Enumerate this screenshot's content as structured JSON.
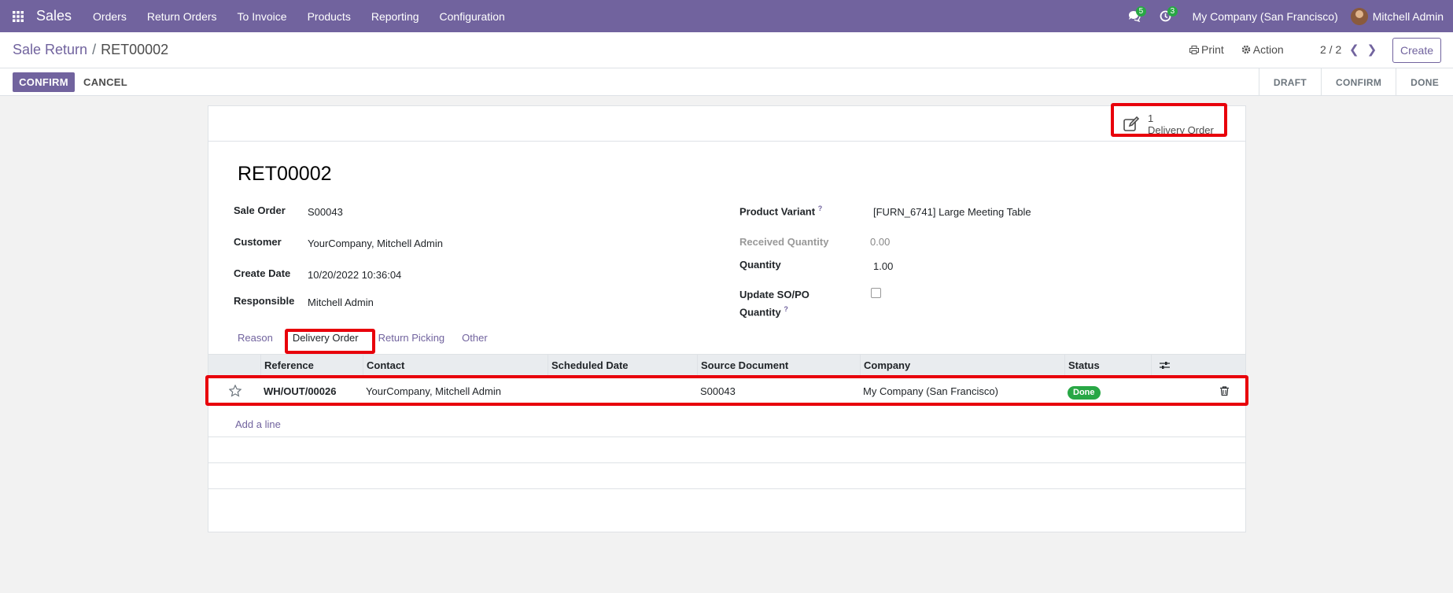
{
  "navbar": {
    "app_name": "Sales",
    "menu": [
      "Orders",
      "Return Orders",
      "To Invoice",
      "Products",
      "Reporting",
      "Configuration"
    ],
    "messages_count": "5",
    "activities_count": "3",
    "company": "My Company (San Francisco)",
    "user": "Mitchell Admin"
  },
  "control": {
    "breadcrumb_parent": "Sale Return",
    "breadcrumb_separator": "/",
    "breadcrumb_current": "RET00002",
    "print_label": "Print",
    "action_label": "Action",
    "pager": "2 / 2",
    "create_label": "Create"
  },
  "statusbar": {
    "confirm_label": "CONFIRM",
    "cancel_label": "CANCEL",
    "stages": [
      "DRAFT",
      "CONFIRM",
      "DONE"
    ]
  },
  "smart_button": {
    "count": "1",
    "label": "Delivery Order"
  },
  "record": {
    "title": "RET00002",
    "left_fields": [
      {
        "label": "Sale Order",
        "value": "S00043"
      },
      {
        "label": "Customer",
        "value": "YourCompany, Mitchell Admin"
      },
      {
        "label": "Create Date",
        "value": "10/20/2022 10:36:04"
      },
      {
        "label": "Responsible",
        "value": "Mitchell Admin"
      }
    ],
    "product_variant_label": "Product Variant",
    "product_variant_value": "[FURN_6741] Large Meeting Table",
    "received_qty_label": "Received Quantity",
    "received_qty_value": "0.00",
    "quantity_label": "Quantity",
    "quantity_value": "1.00",
    "update_qty_label_1": "Update SO/PO",
    "update_qty_label_2": "Quantity",
    "help_mark": "?"
  },
  "tabs": [
    "Reason",
    "Delivery Order",
    "Return Picking",
    "Other"
  ],
  "table": {
    "columns": [
      "Reference",
      "Contact",
      "Scheduled Date",
      "Source Document",
      "Company",
      "Status"
    ],
    "rows": [
      {
        "reference": "WH/OUT/00026",
        "contact": "YourCompany, Mitchell Admin",
        "scheduled_date": "",
        "source_document": "S00043",
        "company": "My Company (San Francisco)",
        "status": "Done"
      }
    ],
    "add_line": "Add a line"
  },
  "colors": {
    "brand": "#71639e",
    "highlight": "#e8000b",
    "status_done": "#28a745"
  }
}
